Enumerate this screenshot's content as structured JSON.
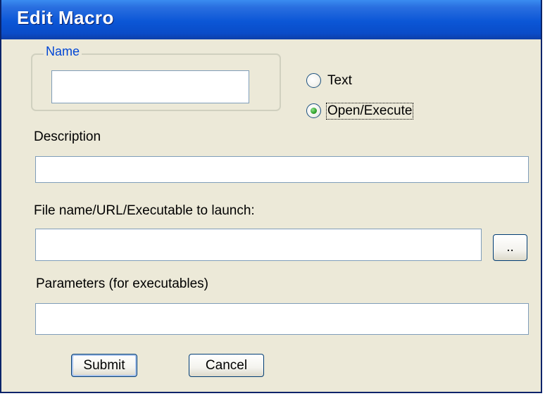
{
  "window": {
    "title": "Edit Macro"
  },
  "name_group": {
    "legend": "Name",
    "value": ""
  },
  "type_options": [
    {
      "label": "Text",
      "selected": false
    },
    {
      "label": "Open/Execute",
      "selected": true
    }
  ],
  "description": {
    "label": "Description",
    "value": ""
  },
  "file": {
    "label": "File name/URL/Executable to launch:",
    "value": "",
    "browse_label": ".."
  },
  "parameters": {
    "label": "Parameters (for executables)",
    "value": ""
  },
  "buttons": {
    "submit_label": "Submit",
    "cancel_label": "Cancel"
  }
}
